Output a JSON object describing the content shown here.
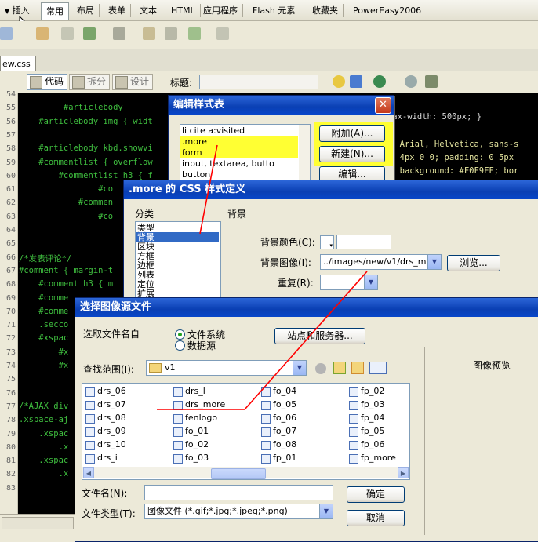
{
  "insert_bar": {
    "tabs": [
      "插入",
      "常用",
      "布局",
      "表单",
      "文本",
      "HTML",
      "应用程序",
      "Flash 元素",
      "收藏夹",
      "PowerEasy2006"
    ],
    "active_index": 1
  },
  "document": {
    "tab_name": "ew.css",
    "view_buttons": {
      "code": "代码",
      "split": "拆分",
      "design": "设计"
    },
    "title_label": "标题:",
    "title_value": ""
  },
  "code": {
    "line_numbers": [
      "54",
      "55",
      "56",
      "57",
      "58",
      "59",
      "60",
      "61",
      "62",
      "63",
      "64",
      "65",
      "66",
      "67",
      "68",
      "69",
      "70",
      "71",
      "72",
      "73",
      "74",
      "75",
      "76",
      "77",
      "78",
      "79",
      "80",
      "81",
      "82",
      "83"
    ],
    "lines": [
      "         #articlebody ",
      "    #articlebody img { widt",
      "",
      "    #articlebody kbd.showvi",
      "    #commentlist { overflow",
      "        #commentlist h3 { f",
      "                #co",
      "            #commen",
      "                #co",
      "",
      "",
      "/*发表评论*/",
      "#comment { margin-t",
      "    #comment h3 { m",
      "    #comme",
      "    #comme",
      "    .secco",
      "    #xspac",
      "        #x",
      "        #x",
      "",
      "",
      "/*AJAX div",
      ".xspace-aj",
      "    .xspac",
      "        .x",
      "    .xspac",
      "        .x"
    ],
    "right_fragments": {
      "l55": "), max-width: 500px; }",
      "l57": "m Arial, Helvetica, sans-s",
      "l58": ": 4px 0 0; padding: 0 5px",
      "l59": "; background: #F0F9FF; bor"
    }
  },
  "style_dialog": {
    "title": "编辑样式表",
    "list_items": [
      "li cite a:visited",
      ".more",
      "form",
      "input, textarea, butto",
      "button"
    ],
    "selected_index": 1,
    "buttons": {
      "attach": "附加(A)...",
      "new": "新建(N)...",
      "edit": "编辑..."
    }
  },
  "css_def_dialog": {
    "title": ".more 的 CSS 样式定义",
    "category_label": "分类",
    "panel_label": "背景",
    "categories": [
      "类型",
      "背景",
      "区块",
      "方框",
      "边框",
      "列表",
      "定位",
      "扩展"
    ],
    "selected_category": 1,
    "bg_color_label": "背景颜色(C):",
    "bg_color_value": "",
    "bg_image_label": "背景图像(I):",
    "bg_image_value": "../images/new/v1/drs_m",
    "browse_button": "浏览...",
    "repeat_label": "重复(R):",
    "repeat_value": ""
  },
  "file_dialog": {
    "title": "选择图像源文件",
    "select_name_from_label": "选取文件名自",
    "radio_filesystem": "文件系统",
    "radio_datasource": "数据源",
    "sites_button": "站点和服务器...",
    "lookin_label": "查找范围(I):",
    "lookin_value": "v1",
    "preview_label": "图像预览",
    "files": [
      [
        "drs_06",
        "drs_07",
        "drs_08",
        "drs_09",
        "drs_10",
        "drs_i"
      ],
      [
        "drs_l",
        "drs_more",
        "fenlogo",
        "fo_01",
        "fo_02",
        "fo_03"
      ],
      [
        "fo_04",
        "fo_05",
        "fo_06",
        "fo_07",
        "fo_08",
        "fp_01"
      ],
      [
        "fp_02",
        "fp_03",
        "fp_04",
        "fp_05",
        "fp_06",
        "fp_more"
      ]
    ],
    "filename_label": "文件名(N):",
    "filename_value": "",
    "filetype_label": "文件类型(T):",
    "filetype_value": "图像文件 (*.gif;*.jpg;*.jpeg;*.png)",
    "ok_button": "确定",
    "cancel_button": "取消"
  },
  "colors": {
    "annotation_red": "#ff0000",
    "highlight_yellow": "#ffff33",
    "selection_blue": "#316ac5",
    "title_blue": "#0a3fb3"
  }
}
